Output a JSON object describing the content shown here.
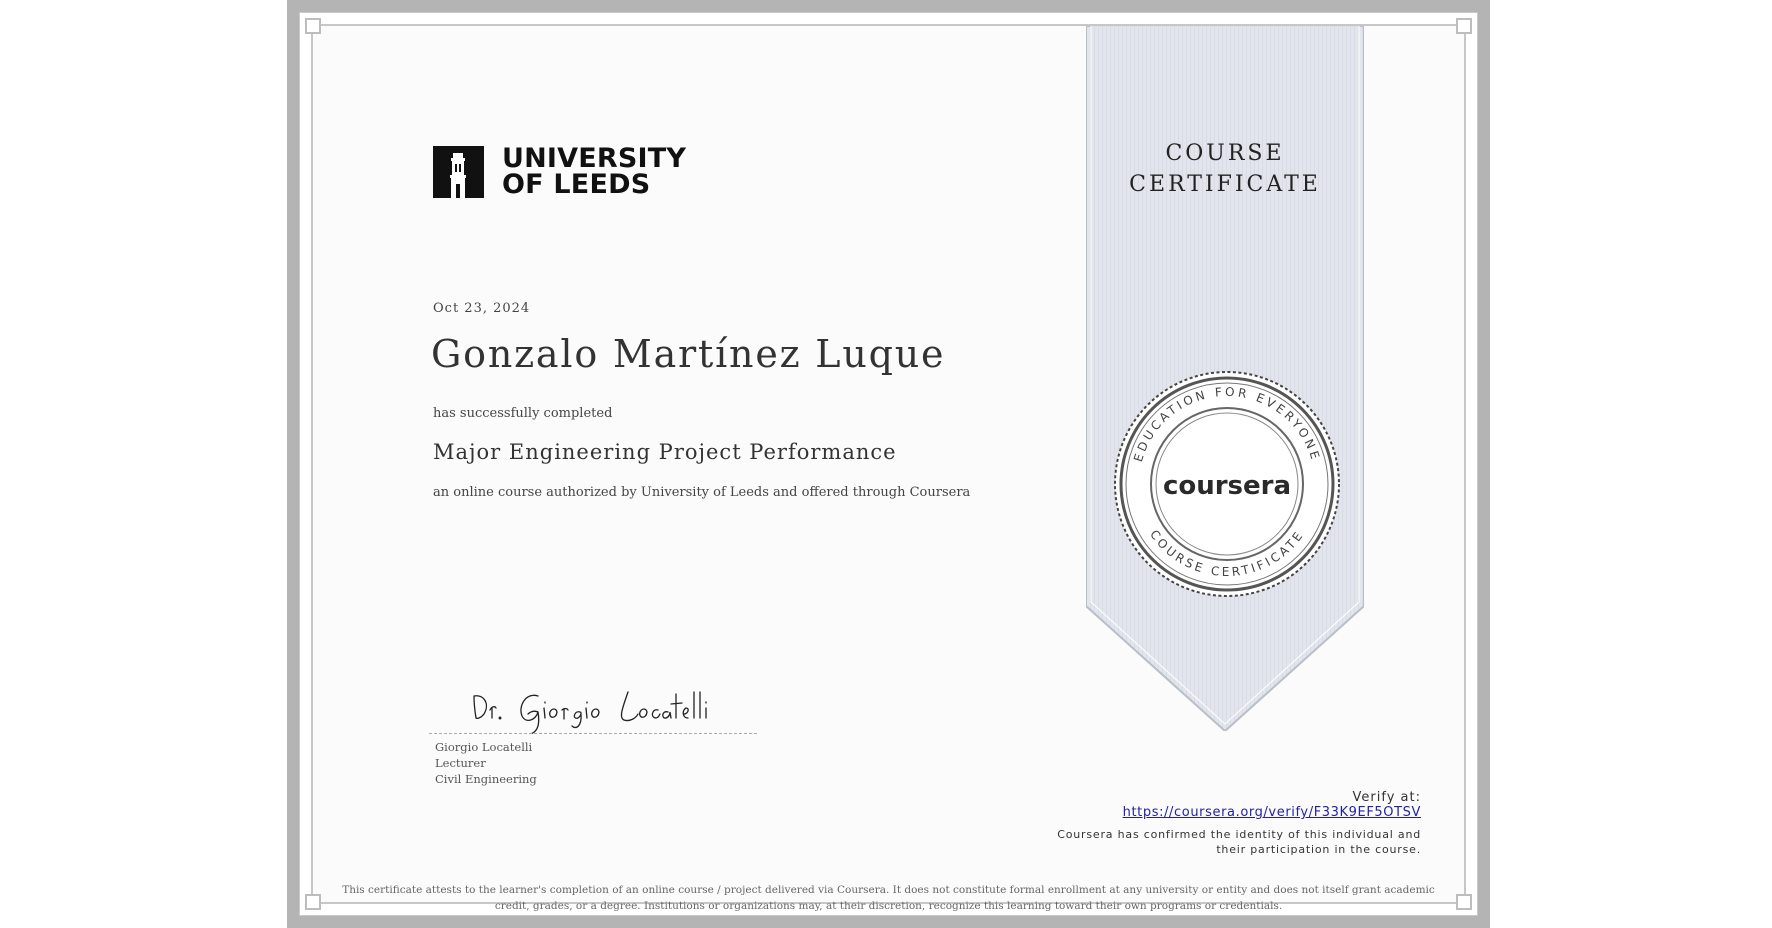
{
  "institution": {
    "name_line1": "UNIVERSITY",
    "name_line2": "OF LEEDS",
    "logo_icon": "building-tower-icon"
  },
  "certificate": {
    "date": "Oct 23, 2024",
    "recipient": "Gonzalo Martínez Luque",
    "completed_text": "has successfully completed",
    "course_title": "Major Engineering Project Performance",
    "authorized_text": "an online course authorized by University of Leeds and offered through Coursera",
    "ribbon_line1": "COURSE",
    "ribbon_line2": "CERTIFICATE"
  },
  "signature": {
    "handwriting": "Dr. Giorgio Locatelli",
    "name": "Giorgio Locatelli",
    "role": "Lecturer",
    "department": "Civil Engineering"
  },
  "seal": {
    "brand": "coursera",
    "ring_top": "EDUCATION FOR EVERYONE",
    "ring_bottom": "COURSE CERTIFICATE"
  },
  "verify": {
    "label": "Verify at:",
    "url": "https://coursera.org/verify/F33K9EF5OTSV",
    "confirmation": "Coursera has confirmed the identity of this individual and their participation in the course."
  },
  "disclaimer": "This certificate attests to the learner's completion of an online course / project delivered via Coursera. It does not constitute formal enrollment at any university or entity and does not itself grant academic credit, grades, or a degree. Institutions or organizations may, at their discretion, recognize this learning toward their own programs or credentials.",
  "colors": {
    "ribbon": "#e2e6ec",
    "link": "#1f1fa8",
    "frame": "#b4b4b4"
  }
}
